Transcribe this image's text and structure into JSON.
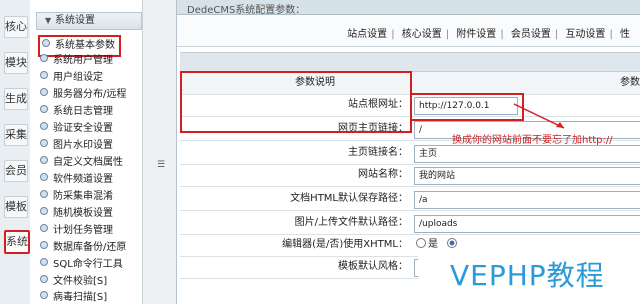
{
  "vtabs": [
    {
      "label": "核心"
    },
    {
      "label": "模块"
    },
    {
      "label": "生成"
    },
    {
      "label": "采集"
    },
    {
      "label": "会员"
    },
    {
      "label": "模板"
    },
    {
      "label": "系统"
    }
  ],
  "menu": {
    "header": "系统设置",
    "items": [
      {
        "label": "系统基本参数"
      },
      {
        "label": "系统用户管理"
      },
      {
        "label": "用户组设定"
      },
      {
        "label": "服务器分布/远程"
      },
      {
        "label": "系统日志管理"
      },
      {
        "label": "验证安全设置"
      },
      {
        "label": "图片水印设置"
      },
      {
        "label": "自定义文档属性"
      },
      {
        "label": "软件频道设置"
      },
      {
        "label": "防采集串混淆"
      },
      {
        "label": "随机模板设置"
      },
      {
        "label": "计划任务管理"
      },
      {
        "label": "数据库备份/还原"
      },
      {
        "label": "SQL命令行工具"
      },
      {
        "label": "文件校验[S]"
      },
      {
        "label": "病毒扫描[S]"
      }
    ]
  },
  "header": {
    "title": "DedeCMS系统配置参数："
  },
  "tabs": [
    {
      "label": "站点设置"
    },
    {
      "label": "核心设置"
    },
    {
      "label": "附件设置"
    },
    {
      "label": "会员设置"
    },
    {
      "label": "互动设置"
    },
    {
      "label": "性"
    }
  ],
  "table": {
    "head_label": "参数说明",
    "head_right": "参数",
    "rows": [
      {
        "label": "站点根网址：",
        "value": "http://127.0.0.1"
      },
      {
        "label": "网页主页链接：",
        "value": "/"
      },
      {
        "label": "主页链接名：",
        "value": "主页"
      },
      {
        "label": "网站名称：",
        "value": "我的网站"
      },
      {
        "label": "文档HTML默认保存路径：",
        "value": "/a"
      },
      {
        "label": "图片/上传文件默认路径：",
        "value": "/uploads"
      },
      {
        "label": "编辑器(是/否)使用XHTML：",
        "value": "是"
      },
      {
        "label": "模板默认风格：",
        "value": ""
      }
    ]
  },
  "annotation": {
    "note": "换成你的网站前面不要忘了加http://",
    "color": "#d21f1f"
  },
  "watermark": {
    "text": "VEPHP教程",
    "color": "#2a9ad8"
  }
}
